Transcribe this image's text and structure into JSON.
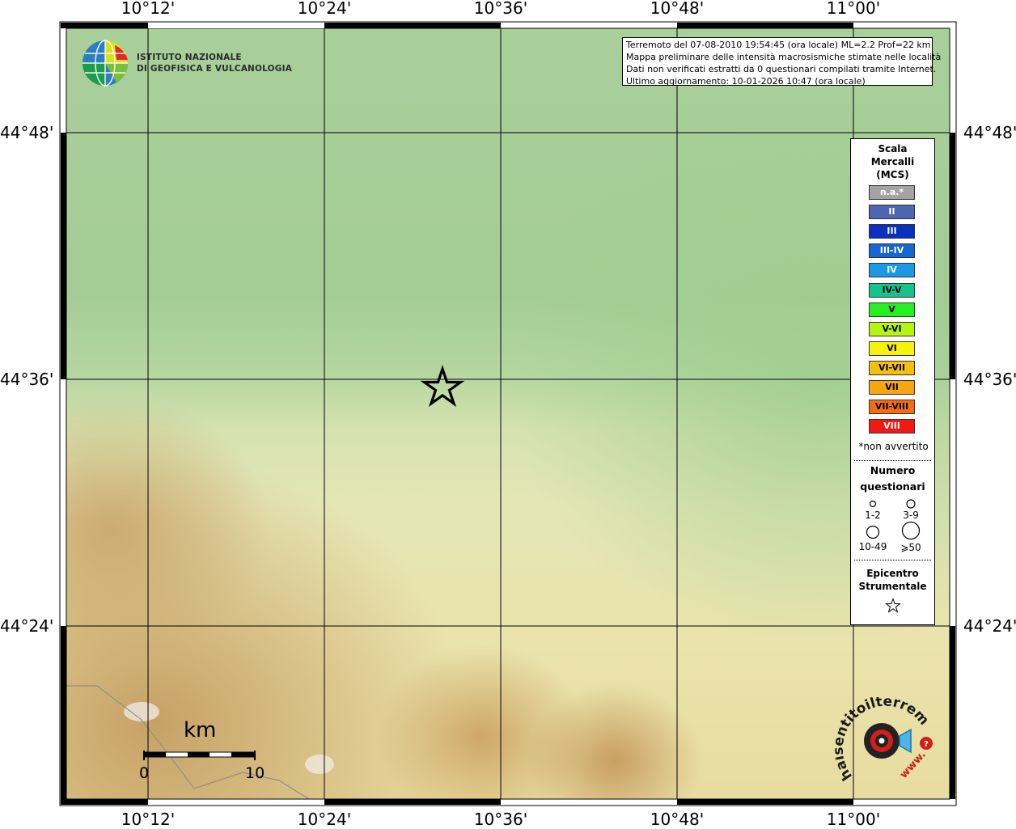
{
  "map": {
    "top_lon_labels": [
      "10°12'",
      "10°24'",
      "10°36'",
      "10°48'",
      "11°00'"
    ],
    "bottom_lon_labels": [
      "10°12'",
      "10°24'",
      "10°36'",
      "10°48'",
      "11°00'"
    ],
    "left_lat_labels": [
      "44°48'",
      "44°36'",
      "44°24'"
    ],
    "right_lat_labels": [
      "44°48'",
      "44°36'",
      "44°24'"
    ]
  },
  "logo": {
    "line1": "ISTITUTO NAZIONALE",
    "line2": "DI GEOFISICA E VULCANOLOGIA"
  },
  "info": {
    "line1": "Terremoto del 07-08-2010 19:54:45 (ora locale) ML=2.2 Prof=22 km",
    "line2": "Mappa preliminare delle intensità macrosismiche stimate nelle località",
    "line3": "Dati non verificati estratti da 0 questionari compilati tramite Internet.",
    "line4": "Ultimo aggiornamento: 10-01-2026 10:47 (ora locale)"
  },
  "legend": {
    "title1": "Scala",
    "title2": "Mercalli",
    "title3": "(MCS)",
    "intensities": [
      {
        "label": "n.a.*",
        "color": "#a3a3a3",
        "text_color": "#ffffff"
      },
      {
        "label": "II",
        "color": "#4c66b2",
        "text_color": "#ffffff"
      },
      {
        "label": "III",
        "color": "#0b2fbf",
        "text_color": "#ffffff"
      },
      {
        "label": "III-IV",
        "color": "#1466d2",
        "text_color": "#ffffff"
      },
      {
        "label": "IV",
        "color": "#1a9ae6",
        "text_color": "#ffffff"
      },
      {
        "label": "IV-V",
        "color": "#13c48c",
        "text_color": "#000000"
      },
      {
        "label": "V",
        "color": "#27f022",
        "text_color": "#000000"
      },
      {
        "label": "V-VI",
        "color": "#b5f510",
        "text_color": "#000000"
      },
      {
        "label": "VI",
        "color": "#f7f20d",
        "text_color": "#000000"
      },
      {
        "label": "VI-VII",
        "color": "#f5c00c",
        "text_color": "#000000"
      },
      {
        "label": "VII",
        "color": "#f7a60d",
        "text_color": "#000000"
      },
      {
        "label": "VII-VIII",
        "color": "#f56d11",
        "text_color": "#000000"
      },
      {
        "label": "VIII",
        "color": "#ee1a13",
        "text_color": "#ffffff"
      }
    ],
    "not_felt_note": "*non avvertito",
    "count_title1": "Numero",
    "count_title2": "questionari",
    "counts": [
      "1-2",
      "3-9",
      "10-49",
      "⩾50"
    ],
    "epicenter_title1": "Epicentro",
    "epicenter_title2": "Strumentale"
  },
  "scale_bar": {
    "unit": "km",
    "start": "0",
    "end": "10"
  },
  "watermark": {
    "text": "haisentitoilterremoto.it",
    "sub": "www."
  }
}
